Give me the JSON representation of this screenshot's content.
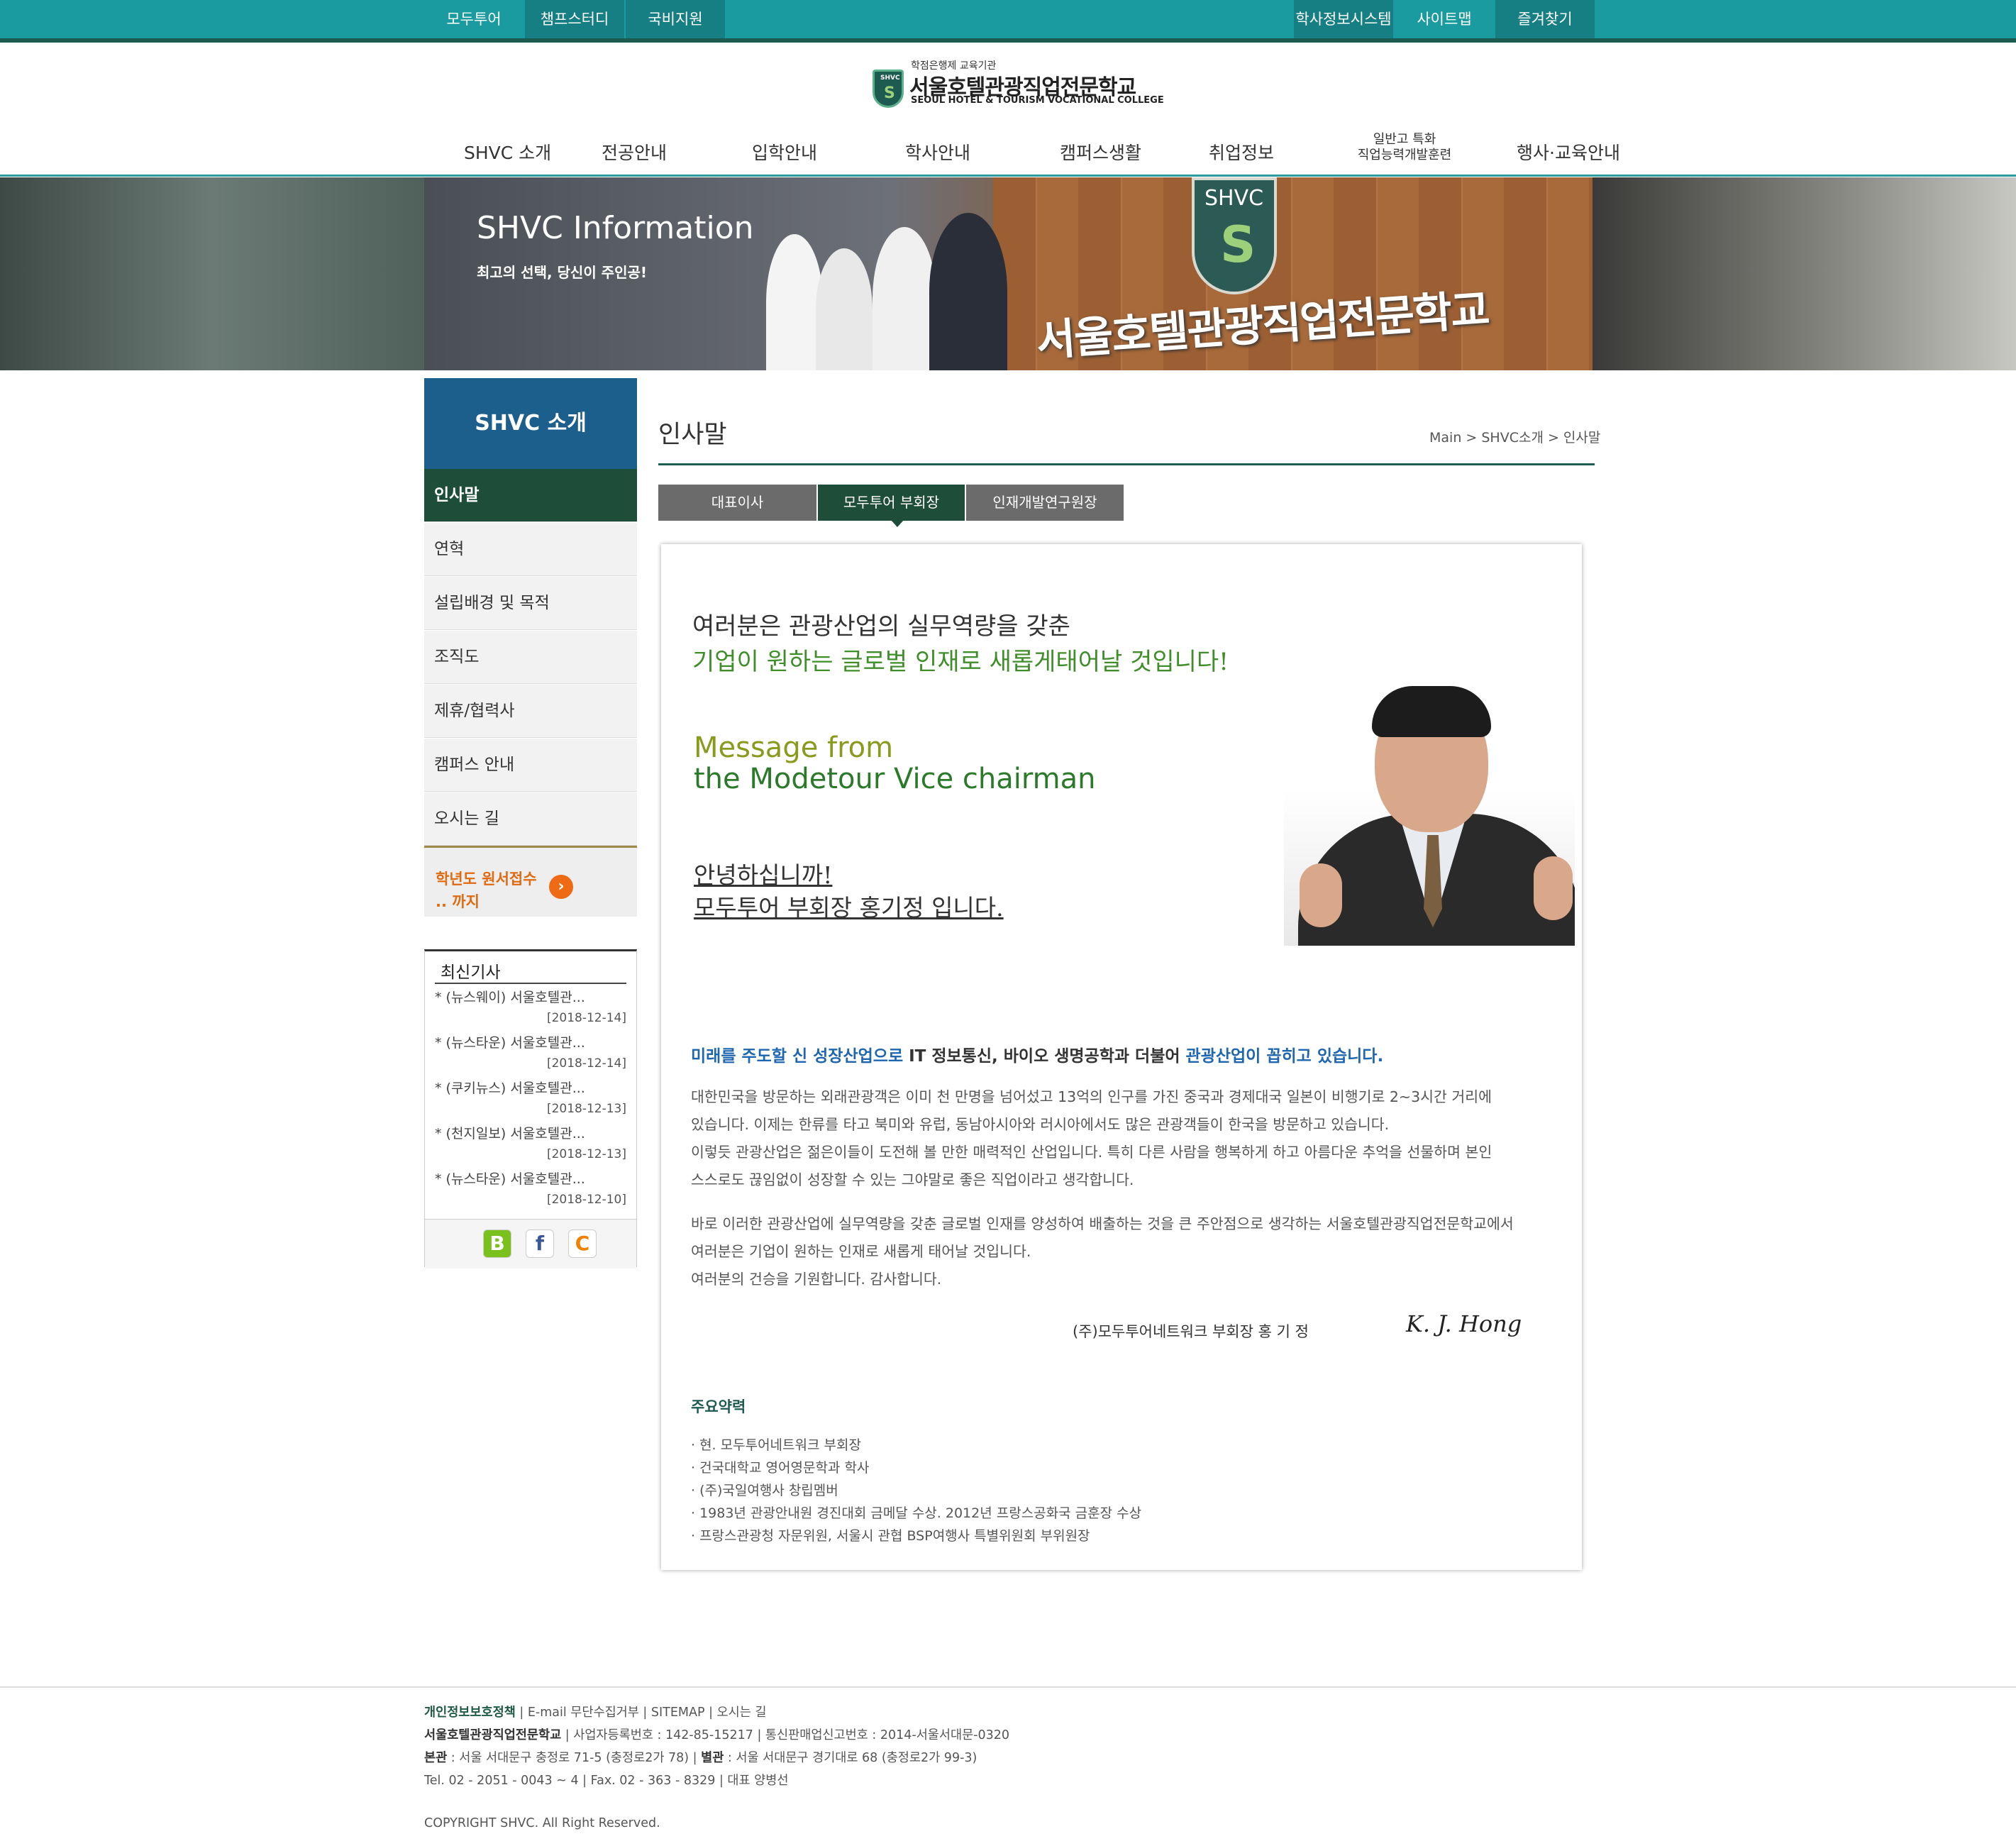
{
  "topbar": {
    "left": [
      "모두투어",
      "챔프스터디",
      "국비지원"
    ],
    "right": [
      "학사정보시스템",
      "사이트맵",
      "즐겨찾기"
    ]
  },
  "logo": {
    "top": "학점은행제 교육기관",
    "name": "서울호텔관광직업전문학교",
    "en": "SEOUL HOTEL & TOURISM VOCATIONAL COLLEGE",
    "badge": "SHVC"
  },
  "gnb": [
    "SHVC 소개",
    "전공안내",
    "입학안내",
    "학사안내",
    "캠퍼스생활",
    "취업정보",
    "일반고 특화",
    "직업능력개발훈련",
    "행사·교육안내"
  ],
  "banner": {
    "title": "SHVC Information",
    "sub": "최고의 선택, 당신이 주인공!",
    "badge": "SHVC",
    "school": "서울호텔관광직업전문학교"
  },
  "lnb": {
    "head": "SHVC 소개",
    "items": [
      "인사말",
      "연혁",
      "설립배경 및 목적",
      "조직도",
      "제휴/협력사",
      "캠퍼스 안내",
      "오시는 길"
    ],
    "apply1": "학년도 원서접수",
    "apply2": ".. 까지"
  },
  "news": {
    "title": "최신기사",
    "items": [
      {
        "t": "* (뉴스웨이) 서울호텔관...",
        "d": "[2018-12-14]"
      },
      {
        "t": "* (뉴스타운) 서울호텔관...",
        "d": "[2018-12-14]"
      },
      {
        "t": "* (쿠키뉴스) 서울호텔관...",
        "d": "[2018-12-13]"
      },
      {
        "t": "* (천지일보) 서울호텔관...",
        "d": "[2018-12-13]"
      },
      {
        "t": "* (뉴스타운) 서울호텔관...",
        "d": "[2018-12-10]"
      }
    ],
    "social": [
      "blog-icon",
      "facebook-icon",
      "cyworld-icon"
    ]
  },
  "content": {
    "title": "인사말",
    "breadcrumb": "Main > SHVC소개 > 인사말",
    "tabs": [
      "대표이사",
      "모두투어 부회장",
      "인재개발연구원장"
    ],
    "headline1": "여러분은 관광산업의 실무역량을 갖춘",
    "headline2": "기업이 원하는 글로벌 인재로 새롭게태어날 것입니다!",
    "msg1": "Message from",
    "msg2": "the Modetour  Vice chairman",
    "greet1": "안녕하십니까!",
    "greet2": "모두투어 부회장 홍기정 입니다.",
    "lead_a": "미래를 주도할 신 성장산업으로 ",
    "lead_b": "IT 정보통신, 바이오 생명공학과 더불어 ",
    "lead_c": "관광산업이 꼽히고 있습니다.",
    "paras": [
      "대한민국을 방문하는 외래관광객은 이미 천 만명을 넘어섰고 13억의 인구를 가진 중국과 경제대국 일본이 비행기로 2~3시간 거리에",
      "있습니다. 이제는 한류를 타고 북미와 유럽, 동남아시아와 러시아에서도 많은 관광객들이 한국을 방문하고 있습니다.",
      "이렇듯 관광산업은 젊은이들이 도전해 볼 만한 매력적인 산업입니다. 특히 다른 사람을 행복하게 하고 아름다운 추억을 선물하며 본인",
      "스스로도 끊임없이 성장할 수 있는 그야말로 좋은 직업이라고 생각합니다.",
      "바로 이러한 관광산업에 실무역량을 갖춘 글로벌 인재를 양성하여 배출하는 것을 큰 주안점으로 생각하는 서울호텔관광직업전문학교에서",
      "여러분은 기업이 원하는 인재로 새롭게 태어날 것입니다.",
      "여러분의 건승을 기원합니다. 감사합니다."
    ],
    "sign": "(주)모두투어네트워크 부회장   홍  기  정",
    "signature": "K. J. Hong",
    "career_title": "주요약력",
    "career": [
      "· 현. 모두투어네트워크 부회장",
      "· 건국대학교 영어영문학과 학사",
      "· (주)국일여행사 창립멤버",
      "· 1983년 관광안내원 경진대회 금메달 수상. 2012년 프랑스공화국 금훈장 수상",
      "· 프랑스관광청 자문위원, 서울시 관협 BSP여행사 특별위원회 부위원장"
    ]
  },
  "footer": {
    "privacy": "개인정보보호정책",
    "links": " | E-mail 무단수집거부 | SITEMAP | 오시는 길",
    "school": "서울호텔관광직업전문학교",
    "biz": "  |  사업자등록번호 : 142-85-15217  |  통신판매업신고번호 : 2014-서울서대문-0320",
    "main_label": "본관",
    "main_addr": " : 서울 서대문구 충정로 71-5 (충정로2가 78)  |  ",
    "annex_label": "별관",
    "annex_addr": " : 서울 서대문구 경기대로 68 (충정로2가 99-3)",
    "tel": "Tel. 02 - 2051 - 0043 ~ 4  |  Fax. 02 - 363 - 8329  |  대표 양병선",
    "copyright": "COPYRIGHT SHVC. All Right Reserved."
  }
}
